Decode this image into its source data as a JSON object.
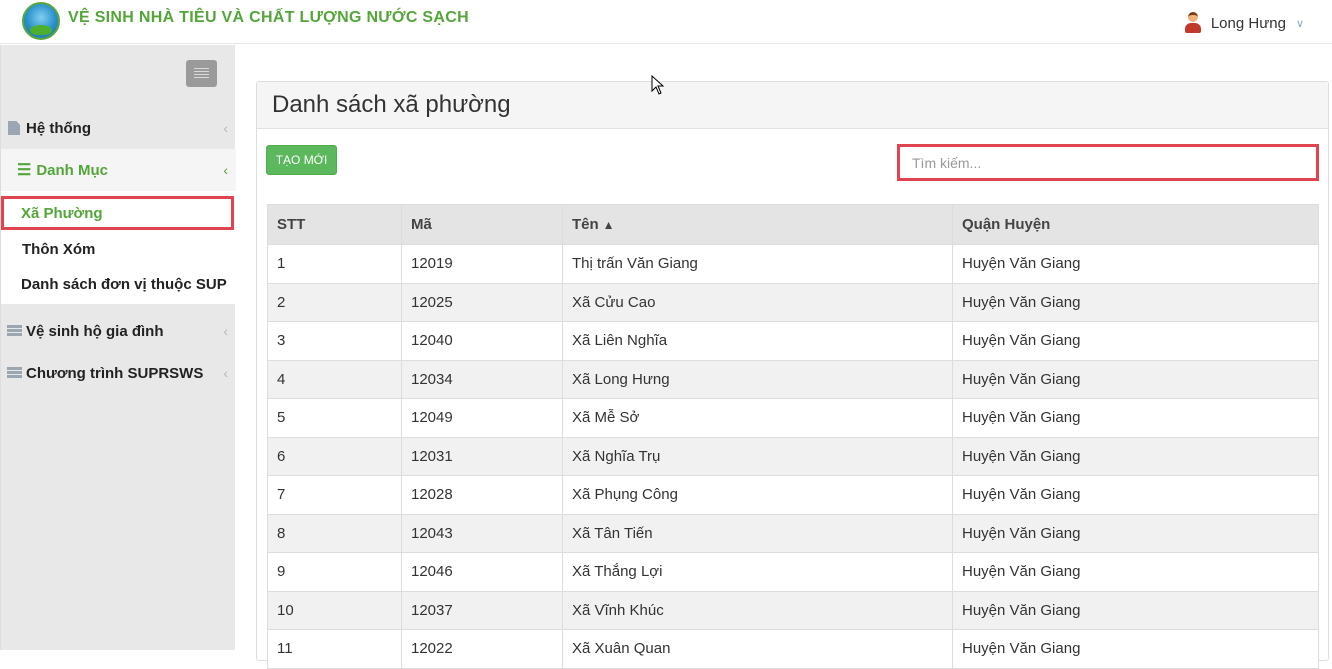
{
  "header": {
    "app_title": "VỆ SINH NHÀ TIÊU VÀ CHẤT LƯỢNG NƯỚC SẠCH",
    "user_name": "Long Hưng"
  },
  "sidebar": {
    "items": [
      {
        "label": "Hệ thống",
        "icon": "file-icon"
      },
      {
        "label": "Danh Mục",
        "icon": "list-icon"
      },
      {
        "label": "Vệ sinh hộ gia đình",
        "icon": "server-icon"
      },
      {
        "label": "Chương trình SUPRSWS",
        "icon": "server-icon"
      }
    ],
    "submenu": [
      {
        "label": "Xã Phường"
      },
      {
        "label": "Thôn Xóm"
      },
      {
        "label": "Danh sách đơn vị thuộc SUP"
      }
    ]
  },
  "main": {
    "title": "Danh sách xã phường",
    "new_button": "TẠO MỚI",
    "search_placeholder": "Tìm kiếm...",
    "table": {
      "headers": [
        "STT",
        "Mã",
        "Tên",
        "Quận Huyện"
      ],
      "rows": [
        [
          "1",
          "12019",
          "Thị trấn Văn Giang",
          "Huyện Văn Giang"
        ],
        [
          "2",
          "12025",
          "Xã Cửu Cao",
          "Huyện Văn Giang"
        ],
        [
          "3",
          "12040",
          "Xã Liên Nghĩa",
          "Huyện Văn Giang"
        ],
        [
          "4",
          "12034",
          "Xã Long Hưng",
          "Huyện Văn Giang"
        ],
        [
          "5",
          "12049",
          "Xã Mễ Sở",
          "Huyện Văn Giang"
        ],
        [
          "6",
          "12031",
          "Xã Nghĩa Trụ",
          "Huyện Văn Giang"
        ],
        [
          "7",
          "12028",
          "Xã Phụng Công",
          "Huyện Văn Giang"
        ],
        [
          "8",
          "12043",
          "Xã Tân Tiến",
          "Huyện Văn Giang"
        ],
        [
          "9",
          "12046",
          "Xã Thắng Lợi",
          "Huyện Văn Giang"
        ],
        [
          "10",
          "12037",
          "Xã Vĩnh Khúc",
          "Huyện Văn Giang"
        ],
        [
          "11",
          "12022",
          "Xã Xuân Quan",
          "Huyện Văn Giang"
        ]
      ]
    }
  }
}
